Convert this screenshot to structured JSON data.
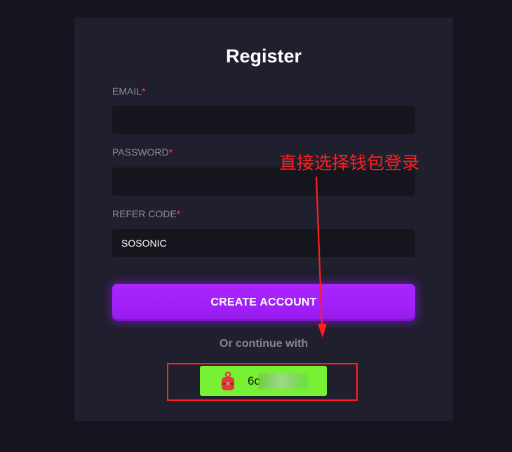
{
  "page": {
    "title": "Register"
  },
  "form": {
    "fields": [
      {
        "label": "EMAIL",
        "required_mark": "*",
        "value": ""
      },
      {
        "label": "PASSWORD",
        "required_mark": "*",
        "value": ""
      },
      {
        "label": "REFER CODE",
        "required_mark": "*",
        "value": "SOSONIC"
      }
    ],
    "submit_label": "CREATE ACCOUNT",
    "alt_login_text": "Or continue with"
  },
  "wallet_button": {
    "icon": "wallet-icon",
    "address_visible": "6c"
  },
  "annotation": {
    "text": "直接选择钱包登录"
  },
  "colors": {
    "background": "#16151f",
    "card": "#201f2d",
    "input": "#15151d",
    "label": "#8c8a99",
    "required": "#e8262c",
    "accent": "#a21ff8",
    "wallet_green": "#77f134",
    "annotation_red": "#ff1f1f"
  }
}
